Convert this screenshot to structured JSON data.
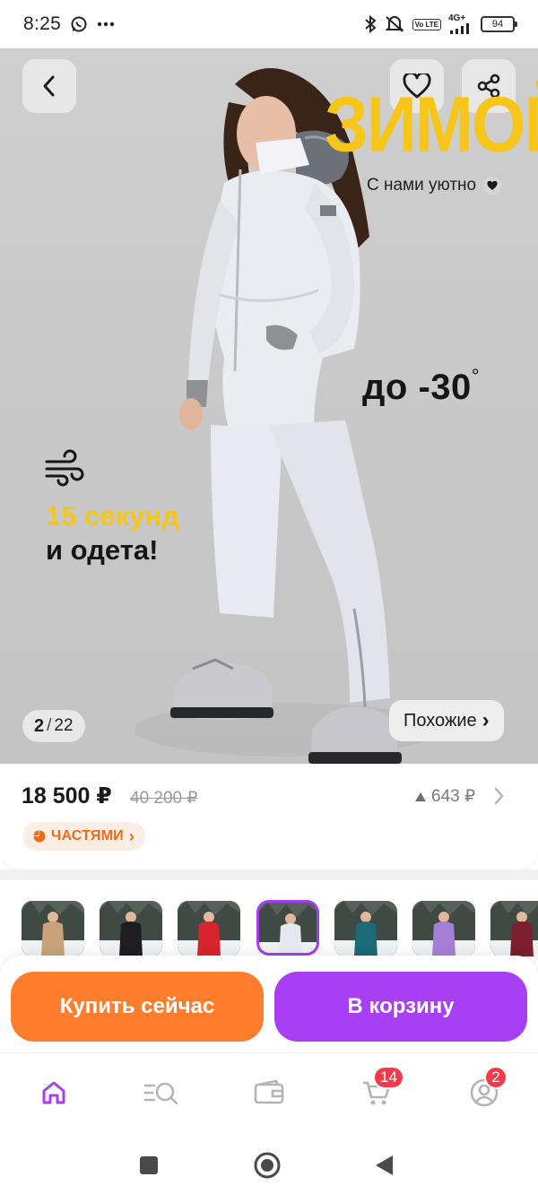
{
  "status_bar": {
    "time": "8:25",
    "network": "4G+",
    "volte": "Vo LTE",
    "battery": "94"
  },
  "hero": {
    "promo_title": "ЗИМОЙ",
    "promo_subtitle": "С нами уютно",
    "temperature": "до -30",
    "temperature_unit": "°",
    "speed_highlight": "15 секунд",
    "speed_text": "и одета!",
    "image_index": "2",
    "image_separator": "/",
    "image_total": "22",
    "similar_label": "Похожие",
    "similar_chevron": "›"
  },
  "price": {
    "current": "18 500 ₽",
    "old": "40 200 ₽",
    "delta": "643 ₽",
    "installment_label": "ЧАСТЯМИ",
    "installment_chevron": "›"
  },
  "variants": [
    {
      "color": "#c8a27a"
    },
    {
      "color": "#1d1d22"
    },
    {
      "color": "#d7242e"
    },
    {
      "color": "#e6e8ef",
      "selected": true
    },
    {
      "color": "#1d6a77"
    },
    {
      "color": "#a57fd6"
    },
    {
      "color": "#7a1f2b"
    }
  ],
  "actions": {
    "buy_now": "Купить сейчас",
    "add_to_cart": "В корзину"
  },
  "tabbar": {
    "home_icon": "home-icon",
    "catalog_icon": "catalog-search-icon",
    "wallet_icon": "wallet-icon",
    "cart_icon": "cart-icon",
    "cart_badge": "14",
    "profile_icon": "profile-icon",
    "profile_badge": "2"
  },
  "colors": {
    "accent_purple": "#a93ff4",
    "accent_orange": "#ff7e2e",
    "promo_yellow": "#f6c61b",
    "badge_red": "#f53a4b"
  }
}
